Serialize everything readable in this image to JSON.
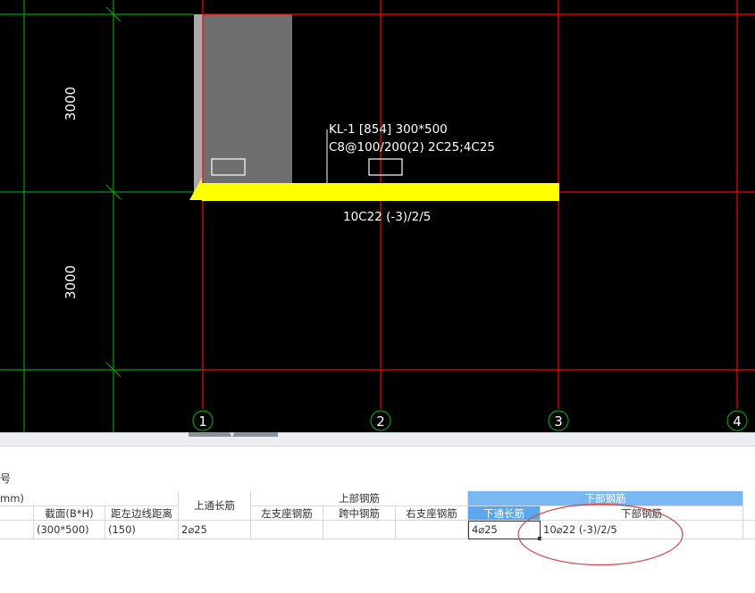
{
  "drawing": {
    "dim_upper": "3000",
    "dim_lower": "3000",
    "beam_label_line1": "KL-1 [854] 300*500",
    "beam_label_line2": "C8@100/200(2) 2C25;4C25",
    "beam_bottom_label": "10C22 (-3)/2/5",
    "axis_labels": [
      "1",
      "2",
      "3",
      "4"
    ],
    "colors": {
      "background": "#000000",
      "grid_red": "#ff0000",
      "grid_green": "#00a000",
      "beam_yellow": "#ffff00",
      "column_gray": "#6f6f6f"
    }
  },
  "panel": {
    "title": "号",
    "unit_header": "mm)",
    "headers": {
      "col0": "",
      "section": "截面(B*H)",
      "edge_offset": "距左边线距离",
      "top_through": "上通长筋",
      "top_group": "上部钢筋",
      "top_left": "左支座钢筋",
      "top_mid": "跨中钢筋",
      "top_right": "右支座钢筋",
      "bottom_group": "下部钢筋",
      "bottom_through": "下通长筋",
      "bottom_rebar": "下部钢筋"
    },
    "row": {
      "section": "(300*500)",
      "edge_offset": "(150)",
      "top_through": "2⌀25",
      "top_left": "",
      "top_mid": "",
      "top_right": "",
      "bottom_through": "4⌀25",
      "bottom_rebar": "10⌀22 (-3)/2/5"
    }
  }
}
